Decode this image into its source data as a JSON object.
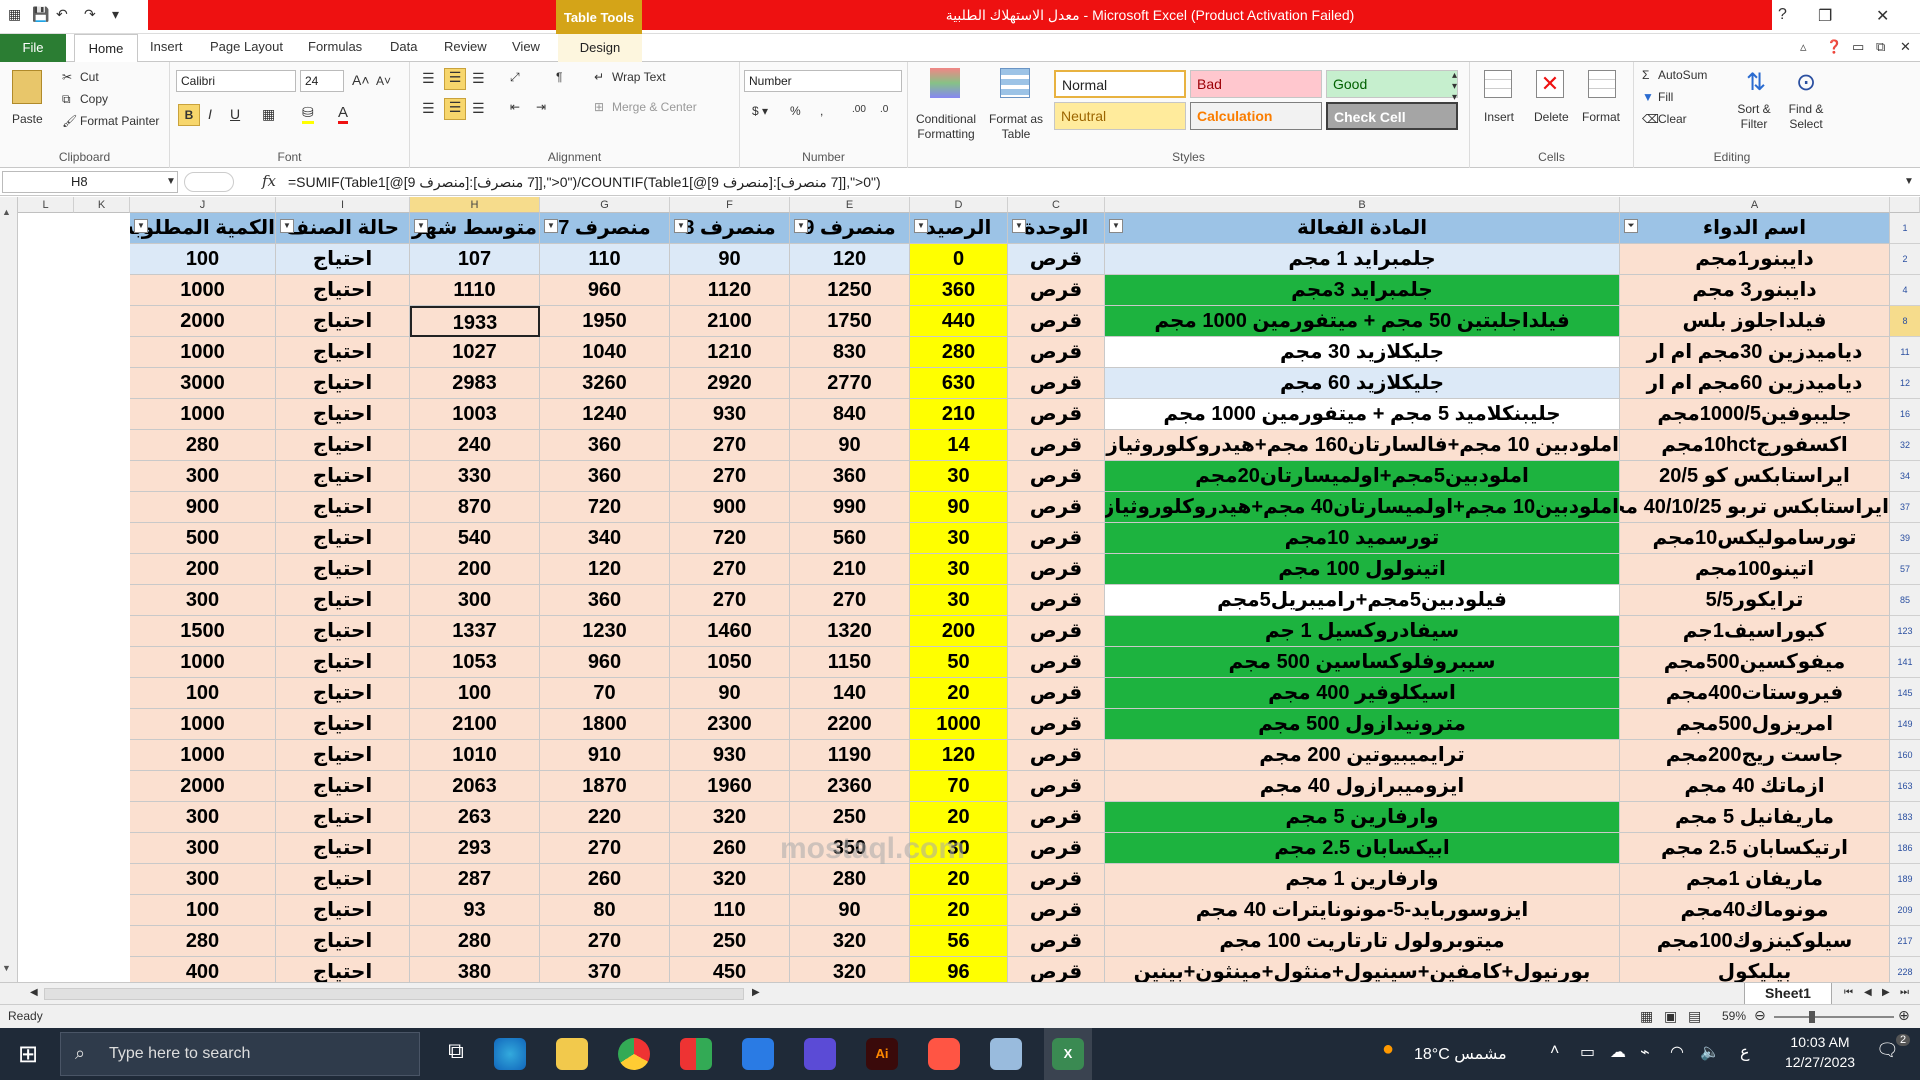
{
  "title_bar": {
    "table_tools": "Table Tools",
    "window_title": "معدل الاستهلاك الطلبية  -  Microsoft Excel (Product Activation Failed)"
  },
  "tabs": {
    "file": "File",
    "home": "Home",
    "insert": "Insert",
    "page_layout": "Page Layout",
    "formulas": "Formulas",
    "data": "Data",
    "review": "Review",
    "view": "View",
    "design": "Design"
  },
  "ribbon": {
    "clipboard": {
      "paste": "Paste",
      "cut": "Cut",
      "copy": "Copy",
      "format_painter": "Format Painter",
      "label": "Clipboard"
    },
    "font": {
      "name": "Calibri",
      "size": "24",
      "label": "Font"
    },
    "alignment": {
      "wrap_text": "Wrap Text",
      "merge_center": "Merge & Center",
      "label": "Alignment"
    },
    "number": {
      "format": "Number",
      "label": "Number"
    },
    "styles": {
      "conditional_formatting": "Conditional Formatting",
      "format_as_table": "Format as Table",
      "normal": "Normal",
      "bad": "Bad",
      "good": "Good",
      "neutral": "Neutral",
      "calculation": "Calculation",
      "check_cell": "Check Cell",
      "label": "Styles"
    },
    "cells": {
      "insert": "Insert",
      "delete": "Delete",
      "format": "Format",
      "label": "Cells"
    },
    "editing": {
      "autosum": "AutoSum",
      "fill": "Fill",
      "clear": "Clear",
      "sort_filter": "Sort & Filter",
      "find_select": "Find & Select",
      "label": "Editing"
    }
  },
  "formula_bar": {
    "name_box": "H8",
    "fx": "fx",
    "formula": "=SUMIF(Table1[@[9 منصرف]:[7 منصرف]],\">0\")/COUNTIF(Table1[@[9 منصرف]:[7 منصرف]],\">0\")"
  },
  "columns": [
    "A",
    "B",
    "C",
    "D",
    "E",
    "F",
    "G",
    "H",
    "I",
    "J",
    "K",
    "L"
  ],
  "headers": {
    "a": "اسم الدواء",
    "b": "المادة الفعالة",
    "c": "الوحدة",
    "d": "الرصيد",
    "e": "منصرف 9",
    "f": "منصرف 8",
    "g": "منصرف 7",
    "h": "متوسط شهر",
    "i": "حالة الصنف",
    "j": "الكمية المطلوبة"
  },
  "rows": [
    {
      "n": "2",
      "a": "دايبنور1مجم",
      "b": "جلمبرايد 1 مجم",
      "c": "قرص",
      "d": "0",
      "e": "120",
      "f": "90",
      "g": "110",
      "h": "107",
      "i": "احتياج",
      "j": "100",
      "bc": "#dce9f7"
    },
    {
      "n": "4",
      "a": "دايبنور3 مجم",
      "b": "جلمبرايد 3مجم",
      "c": "قرص",
      "d": "360",
      "e": "1250",
      "f": "1120",
      "g": "960",
      "h": "1110",
      "i": "احتياج",
      "j": "1000",
      "bc": "#1db33f"
    },
    {
      "n": "8",
      "a": "فيلداجلوز بلس",
      "b": "فيلداجلبتين 50 مجم + ميتفورمين 1000 مجم",
      "c": "قرص",
      "d": "440",
      "e": "1750",
      "f": "2100",
      "g": "1950",
      "h": "1933",
      "i": "احتياج",
      "j": "2000",
      "bc": "#1db33f"
    },
    {
      "n": "11",
      "a": "دياميدزين 30مجم ام ار",
      "b": "جليكلازيد 30 مجم",
      "c": "قرص",
      "d": "280",
      "e": "830",
      "f": "1210",
      "g": "1040",
      "h": "1027",
      "i": "احتياج",
      "j": "1000",
      "bc": "#ffffff"
    },
    {
      "n": "12",
      "a": "دياميدزين 60مجم ام ار",
      "b": "جليكلازيد 60 مجم",
      "c": "قرص",
      "d": "630",
      "e": "2770",
      "f": "2920",
      "g": "3260",
      "h": "2983",
      "i": "احتياج",
      "j": "3000",
      "bc": "#dce9f7"
    },
    {
      "n": "16",
      "a": "جليبوفين1000/5مجم",
      "b": "جليبنكلاميد 5 مجم + ميتفورمين 1000 مجم",
      "c": "قرص",
      "d": "210",
      "e": "840",
      "f": "930",
      "g": "1240",
      "h": "1003",
      "i": "احتياج",
      "j": "1000",
      "bc": "#ffffff"
    },
    {
      "n": "32",
      "a": "اكسفورج10hctمجم",
      "b": "املودبين 10 مجم+فالسارتان160 مجم+هيدروكلوروثيازيد 25 مجم",
      "c": "قرص",
      "d": "14",
      "e": "90",
      "f": "270",
      "g": "360",
      "h": "240",
      "i": "احتياج",
      "j": "280",
      "bc": "#fbe0d0"
    },
    {
      "n": "34",
      "a": "ايراستابكس كو 20/5",
      "b": "املودبين5مجم+اولميسارتان20مجم",
      "c": "قرص",
      "d": "30",
      "e": "360",
      "f": "270",
      "g": "360",
      "h": "330",
      "i": "احتياج",
      "j": "300",
      "bc": "#1db33f"
    },
    {
      "n": "37",
      "a": "ايراستابكس تربو 40/10/25 مجم",
      "b": "املودبين10 مجم+اولميسارتان40 مجم+هيدروكلوروثيازيد 25 مجم",
      "c": "قرص",
      "d": "90",
      "e": "990",
      "f": "900",
      "g": "720",
      "h": "870",
      "i": "احتياج",
      "j": "900",
      "bc": "#1db33f"
    },
    {
      "n": "39",
      "a": "تورساموليكس10مجم",
      "b": "تورسميد 10مجم",
      "c": "قرص",
      "d": "30",
      "e": "560",
      "f": "720",
      "g": "340",
      "h": "540",
      "i": "احتياج",
      "j": "500",
      "bc": "#1db33f"
    },
    {
      "n": "57",
      "a": "اتينو100مجم",
      "b": "اتينولول 100 مجم",
      "c": "قرص",
      "d": "30",
      "e": "210",
      "f": "270",
      "g": "120",
      "h": "200",
      "i": "احتياج",
      "j": "200",
      "bc": "#1db33f"
    },
    {
      "n": "85",
      "a": "ترايكور5/5",
      "b": "فيلودبين5مجم+راميبريل5مجم",
      "c": "قرص",
      "d": "30",
      "e": "270",
      "f": "270",
      "g": "360",
      "h": "300",
      "i": "احتياج",
      "j": "300",
      "bc": "#ffffff"
    },
    {
      "n": "123",
      "a": "كيوراسيف1جم",
      "b": "سيفادروكسيل 1 جم",
      "c": "قرص",
      "d": "200",
      "e": "1320",
      "f": "1460",
      "g": "1230",
      "h": "1337",
      "i": "احتياج",
      "j": "1500",
      "bc": "#1db33f"
    },
    {
      "n": "141",
      "a": "ميفوكسين500مجم",
      "b": "سيبروفلوكساسين 500 مجم",
      "c": "قرص",
      "d": "50",
      "e": "1150",
      "f": "1050",
      "g": "960",
      "h": "1053",
      "i": "احتياج",
      "j": "1000",
      "bc": "#1db33f"
    },
    {
      "n": "145",
      "a": "فيروستات400مجم",
      "b": "اسيكلوفير 400 مجم",
      "c": "قرص",
      "d": "20",
      "e": "140",
      "f": "90",
      "g": "70",
      "h": "100",
      "i": "احتياج",
      "j": "100",
      "bc": "#1db33f"
    },
    {
      "n": "149",
      "a": "امريزول500مجم",
      "b": "مترونيدازول 500 مجم",
      "c": "قرص",
      "d": "1000",
      "e": "2200",
      "f": "2300",
      "g": "1800",
      "h": "2100",
      "i": "احتياج",
      "j": "1000",
      "bc": "#1db33f"
    },
    {
      "n": "160",
      "a": "جاست ريج200مجم",
      "b": "ترايميبيوتين 200 مجم",
      "c": "قرص",
      "d": "120",
      "e": "1190",
      "f": "930",
      "g": "910",
      "h": "1010",
      "i": "احتياج",
      "j": "1000",
      "bc": "#fbe0d0"
    },
    {
      "n": "163",
      "a": "ازماتك 40 مجم",
      "b": "ايزوميبرازول 40 مجم",
      "c": "قرص",
      "d": "70",
      "e": "2360",
      "f": "1960",
      "g": "1870",
      "h": "2063",
      "i": "احتياج",
      "j": "2000",
      "bc": "#fbe0d0"
    },
    {
      "n": "183",
      "a": "ماريفانيل 5 مجم",
      "b": "وارفارين 5 مجم",
      "c": "قرص",
      "d": "20",
      "e": "250",
      "f": "320",
      "g": "220",
      "h": "263",
      "i": "احتياج",
      "j": "300",
      "bc": "#1db33f"
    },
    {
      "n": "186",
      "a": "ارتيكسابان 2.5 مجم",
      "b": "ابيكسابان 2.5 مجم",
      "c": "قرص",
      "d": "30",
      "e": "350",
      "f": "260",
      "g": "270",
      "h": "293",
      "i": "احتياج",
      "j": "300",
      "bc": "#1db33f"
    },
    {
      "n": "189",
      "a": "ماريفان 1مجم",
      "b": "وارفارين 1 مجم",
      "c": "قرص",
      "d": "20",
      "e": "280",
      "f": "320",
      "g": "260",
      "h": "287",
      "i": "احتياج",
      "j": "300",
      "bc": "#fbe0d0"
    },
    {
      "n": "209",
      "a": "مونوماك40مجم",
      "b": "ايزوسوربايد-5-مونونايترات 40 مجم",
      "c": "قرص",
      "d": "20",
      "e": "90",
      "f": "110",
      "g": "80",
      "h": "93",
      "i": "احتياج",
      "j": "100",
      "bc": "#fbe0d0"
    },
    {
      "n": "217",
      "a": "سيلوكينزوك100مجم",
      "b": "ميتوبرولول تارتاريت 100 مجم",
      "c": "قرص",
      "d": "56",
      "e": "320",
      "f": "250",
      "g": "270",
      "h": "280",
      "i": "احتياج",
      "j": "280",
      "bc": "#fbe0d0"
    },
    {
      "n": "228",
      "a": "بيليكول",
      "b": "بورنيول+كامفين+سينيول+منثول+مينثون+بينين",
      "c": "قرص",
      "d": "96",
      "e": "320",
      "f": "450",
      "g": "370",
      "h": "380",
      "i": "احتياج",
      "j": "400",
      "bc": "#fbe0d0"
    }
  ],
  "sheet": {
    "tab": "Sheet1"
  },
  "status": {
    "ready": "Ready",
    "zoom": "59%"
  },
  "taskbar": {
    "search_placeholder": "Type here to search",
    "weather": "18°C  مشمس",
    "lang": "ع",
    "time": "10:03 AM",
    "date": "12/27/2023",
    "notifications": "2"
  },
  "watermark": {
    "text": "mostaql.com"
  },
  "colors": {
    "ribbon_green": "#2b7d33",
    "header_blue": "#9cc3e6",
    "balance_yellow": "#ffff00",
    "row_peach": "#fbe0d0",
    "title_red": "#e11111"
  }
}
